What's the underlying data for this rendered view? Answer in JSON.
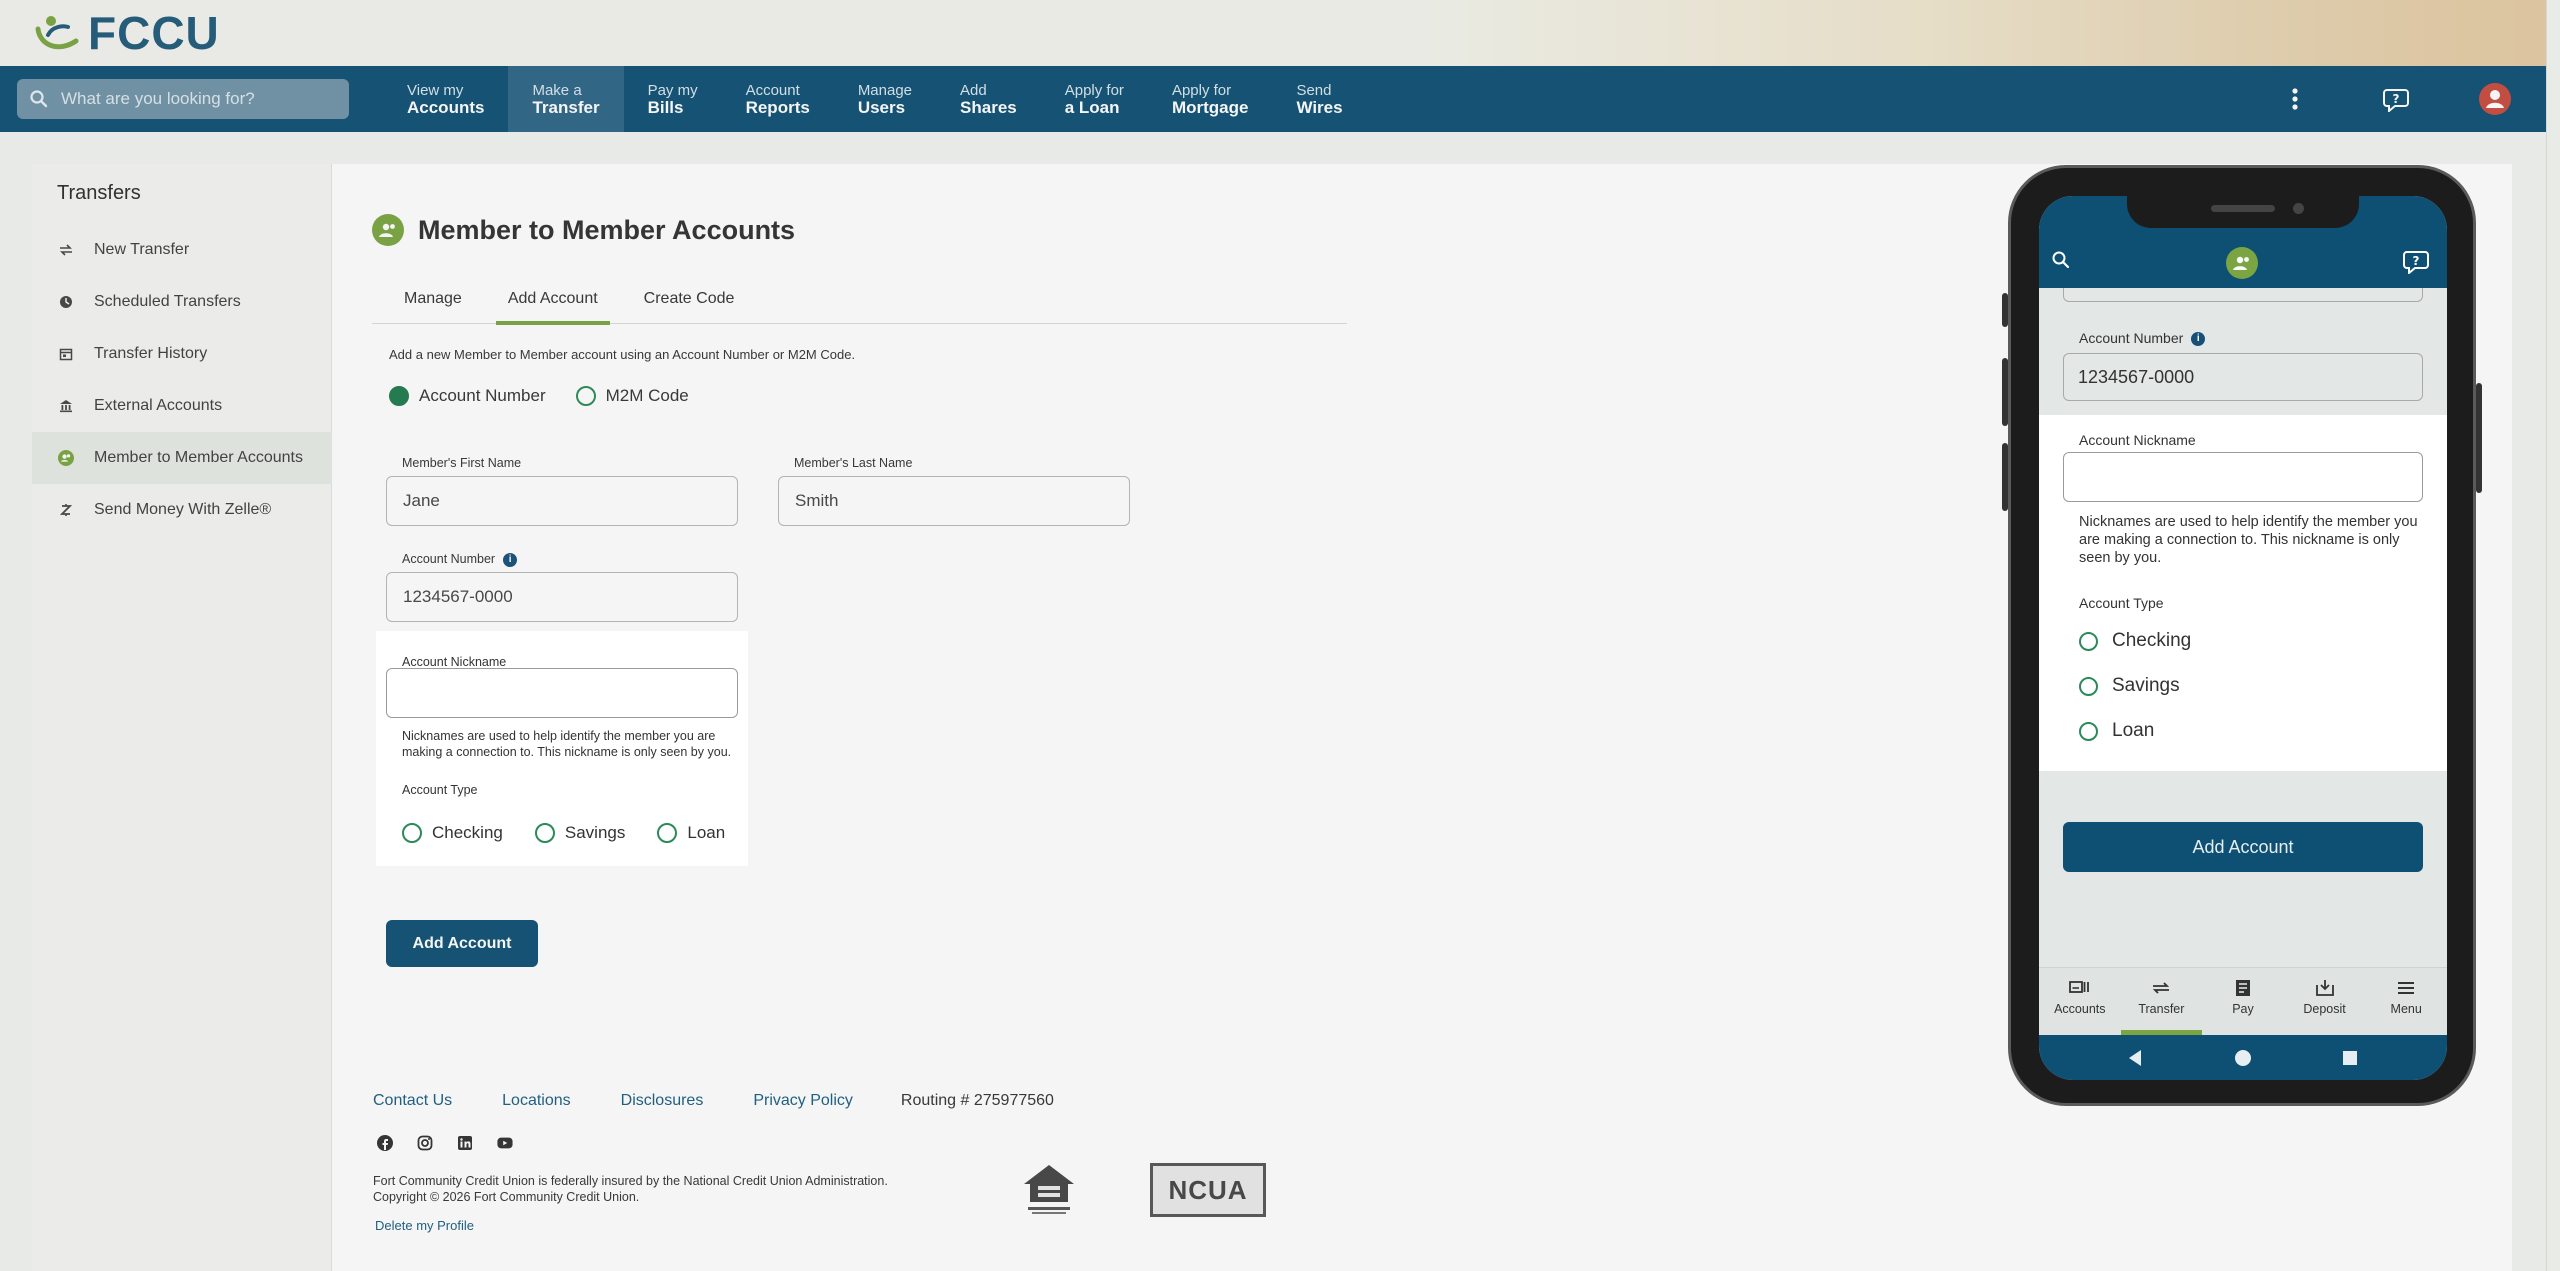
{
  "brand": {
    "logo_text": "FCCU",
    "logo_color": "#1f5a7a",
    "accent": "#7aa542",
    "nav_bg": "#0e4f74"
  },
  "search": {
    "placeholder": "What are you looking for?"
  },
  "nav": [
    {
      "l1": "View my",
      "l2": "Accounts"
    },
    {
      "l1": "Make a",
      "l2": "Transfer",
      "active": true
    },
    {
      "l1": "Pay my",
      "l2": "Bills"
    },
    {
      "l1": "Account",
      "l2": "Reports"
    },
    {
      "l1": "Manage",
      "l2": "Users"
    },
    {
      "l1": "Add",
      "l2": "Shares"
    },
    {
      "l1": "Apply for",
      "l2": "a Loan"
    },
    {
      "l1": "Apply for",
      "l2": "Mortgage"
    },
    {
      "l1": "Send",
      "l2": "Wires"
    }
  ],
  "nav_right_icons": [
    "more-vertical-icon",
    "help-chat-icon",
    "user-avatar-icon"
  ],
  "sidebar": {
    "title": "Transfers",
    "items": [
      {
        "label": "New Transfer",
        "icon": "arrows-swap-icon"
      },
      {
        "label": "Scheduled Transfers",
        "icon": "clock-icon"
      },
      {
        "label": "Transfer History",
        "icon": "calendar-icon"
      },
      {
        "label": "External Accounts",
        "icon": "bank-icon"
      },
      {
        "label": "Member to Member Accounts",
        "icon": "members-icon",
        "active": true
      },
      {
        "label": "Send Money With Zelle®",
        "icon": "zelle-icon"
      }
    ]
  },
  "main": {
    "title": "Member to Member Accounts",
    "tabs": [
      {
        "label": "Manage"
      },
      {
        "label": "Add Account",
        "active": true
      },
      {
        "label": "Create Code"
      }
    ],
    "intro": "Add a new Member to Member account using an Account Number or M2M Code.",
    "method_options": [
      {
        "label": "Account Number",
        "selected": true
      },
      {
        "label": "M2M Code",
        "selected": false
      }
    ],
    "first_name": {
      "label": "Member's First Name",
      "value": "Jane"
    },
    "last_name": {
      "label": "Member's Last Name",
      "value": "Smith"
    },
    "account_number": {
      "label": "Account Number",
      "value": "1234567-0000",
      "info": "i"
    },
    "nickname": {
      "label": "Account Nickname",
      "value": "",
      "help": "Nicknames are used to help identify the member you are making a connection to. This nickname is only seen by you."
    },
    "account_type": {
      "label": "Account Type",
      "options": [
        "Checking",
        "Savings",
        "Loan"
      ]
    },
    "add_button": "Add Account"
  },
  "footer": {
    "links": [
      "Contact Us",
      "Locations",
      "Disclosures",
      "Privacy Policy"
    ],
    "routing": "Routing # 275977560",
    "socials": [
      "facebook-icon",
      "instagram-icon",
      "linkedin-icon",
      "youtube-icon"
    ],
    "disclaimer_1": "Fort Community Credit Union is federally insured by the National Credit Union Administration.",
    "disclaimer_2": "Copyright © 2026 Fort Community Credit Union.",
    "delete_profile": "Delete my Profile",
    "ncua": "NCUA"
  },
  "phone": {
    "account_number_label": "Account Number",
    "account_number_value": "1234567-0000",
    "nickname_label": "Account Nickname",
    "nickname_help": "Nicknames are used to help identify the member you are making a connection to. This nickname is only seen by you.",
    "account_type_label": "Account Type",
    "options": [
      "Checking",
      "Savings",
      "Loan"
    ],
    "add_button": "Add Account",
    "tabs": [
      {
        "label": "Accounts",
        "icon": "accounts-icon"
      },
      {
        "label": "Transfer",
        "icon": "transfer-icon",
        "active": true
      },
      {
        "label": "Pay",
        "icon": "pay-icon"
      },
      {
        "label": "Deposit",
        "icon": "deposit-icon"
      },
      {
        "label": "Menu",
        "icon": "menu-icon"
      }
    ]
  }
}
